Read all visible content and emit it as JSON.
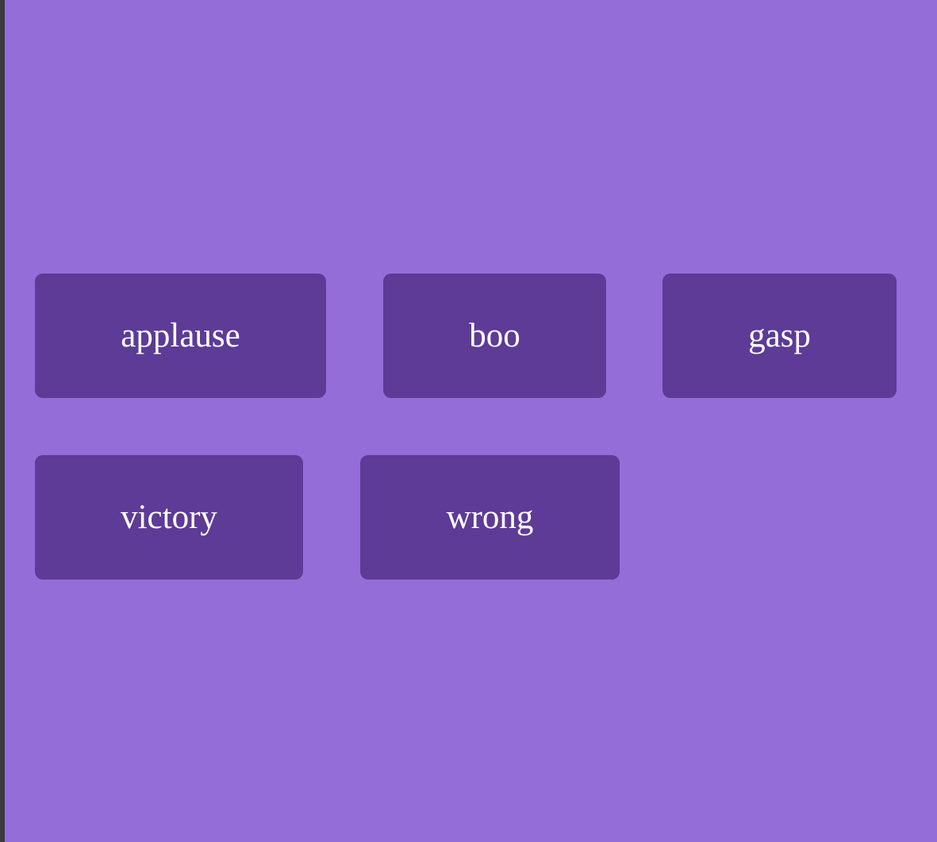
{
  "theme": {
    "background": "#956dd8",
    "button_background": "#5d3b96",
    "button_text": "#ffffff",
    "left_edge": "#3b3b3b"
  },
  "sound_buttons": [
    {
      "label": "applause"
    },
    {
      "label": "boo"
    },
    {
      "label": "gasp"
    },
    {
      "label": "victory"
    },
    {
      "label": "wrong"
    }
  ]
}
